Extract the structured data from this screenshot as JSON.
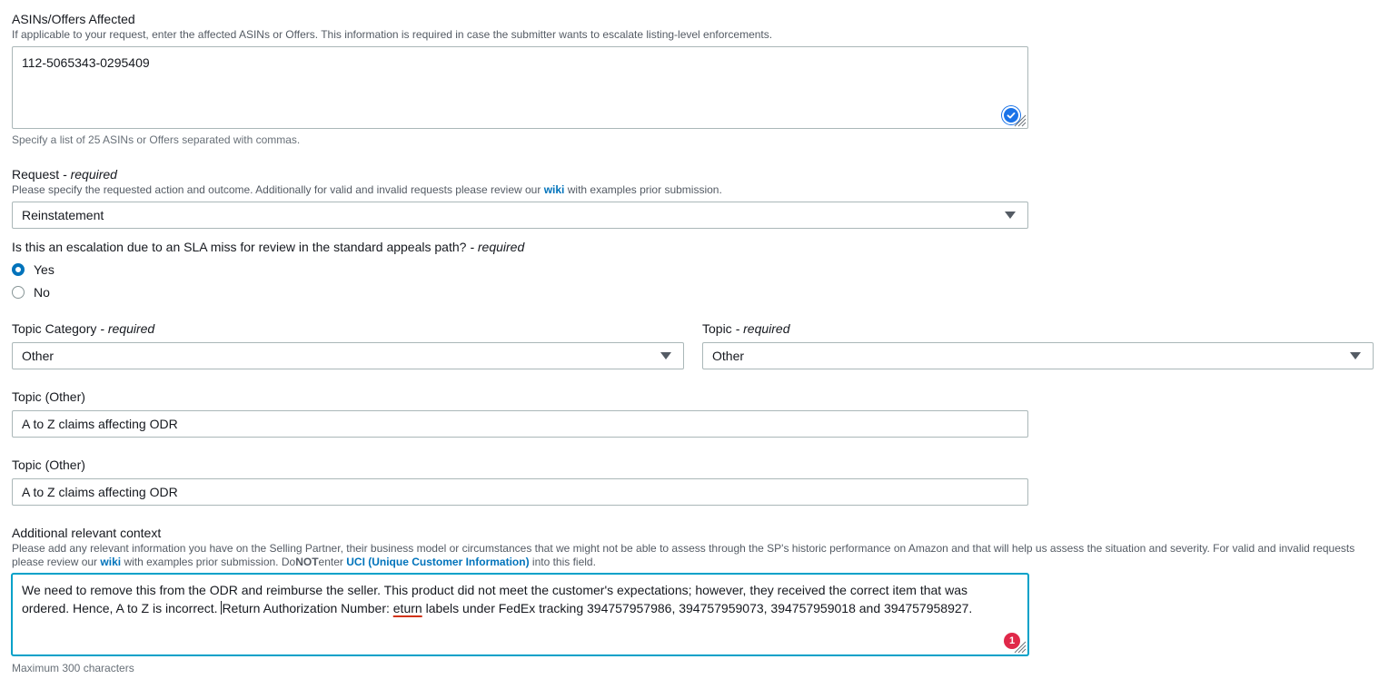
{
  "asins": {
    "label": "ASINs/Offers Affected",
    "description": "If applicable to your request, enter the affected ASINs or Offers. This information is required in case the submitter wants to escalate listing-level enforcements.",
    "value": "112-5065343-0295409",
    "constraint": "Specify a list of 25 ASINs or Offers separated with commas."
  },
  "request": {
    "label": "Request",
    "required_text": "- required",
    "description_prefix": "Please specify the requested action and outcome. Additionally for valid and invalid requests please review our",
    "wiki_link": "wiki",
    "description_suffix": "with examples prior submission.",
    "selected": "Reinstatement"
  },
  "escalation": {
    "label": "Is this an escalation due to an SLA miss for review in the standard appeals path?",
    "required_text": "- required",
    "options": [
      {
        "label": "Yes",
        "checked": true
      },
      {
        "label": "No",
        "checked": false
      }
    ]
  },
  "topic_category": {
    "label": "Topic Category",
    "required_text": "- required",
    "selected": "Other"
  },
  "topic": {
    "label": "Topic",
    "required_text": "- required",
    "selected": "Other"
  },
  "topic_other_1": {
    "label": "Topic (Other)",
    "value": "A to Z claims affecting ODR"
  },
  "topic_other_2": {
    "label": "Topic (Other)",
    "value": "A to Z claims affecting ODR"
  },
  "context": {
    "label": "Additional relevant context",
    "description_prefix": "Please add any relevant information you have on the Selling Partner, their business model or circumstances that we might not be able to assess through the SP's historic performance on Amazon and that will help us assess the situation and severity. For valid and invalid requests please review our",
    "wiki_link": "wiki",
    "description_mid": "with examples prior submission. Do",
    "not_text": "NOT",
    "enter_text": "enter",
    "uci_link": "UCI (Unique Customer Information)",
    "description_suffix": "into this field.",
    "value_line1": "We need to remove this from the ODR and reimburse the seller. This product did not meet the customer's expectations; however, they received the correct item that was",
    "value_line2_a": "ordered. Hence, A to Z is incorrect.",
    "value_line2_b": "Return Authorization Number:",
    "value_misspelled": "eturn",
    "value_line2_c": "labels under FedEx tracking 394757957986, 394757959073, 394757959018 and 394757958927.",
    "error_count": "1",
    "constraint": "Maximum 300 characters"
  }
}
